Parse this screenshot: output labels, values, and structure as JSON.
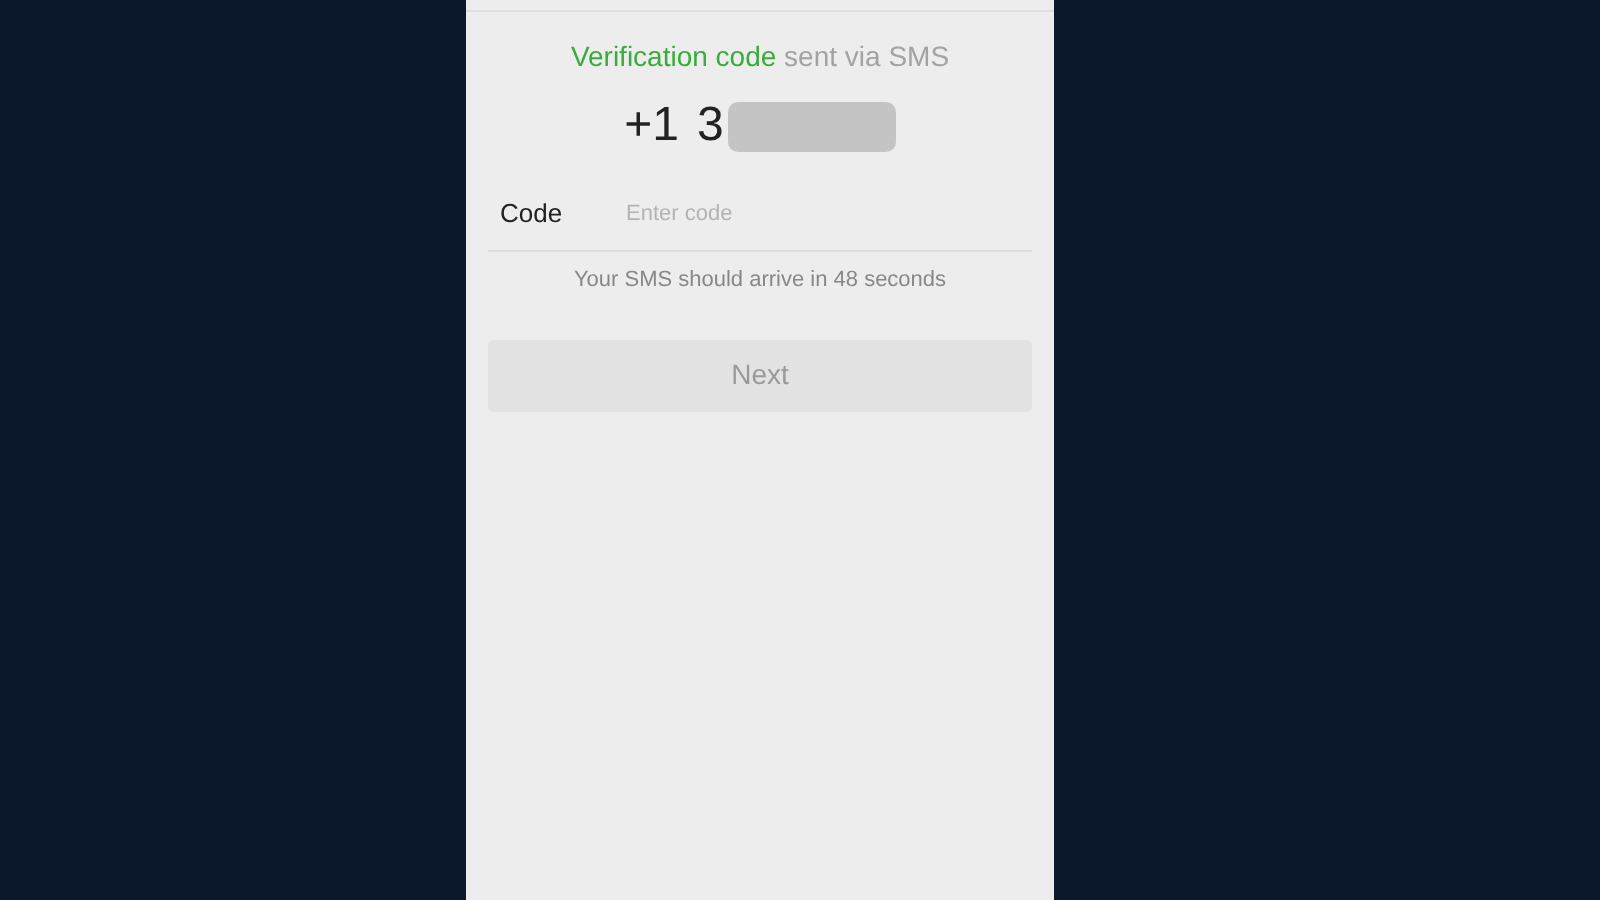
{
  "heading": {
    "highlight": "Verification code",
    "text": "sent via SMS"
  },
  "phone": {
    "prefix": "+1",
    "visible_digits": "3",
    "redacted": true
  },
  "code_field": {
    "label": "Code",
    "placeholder": "Enter code"
  },
  "hint": "Your SMS should arrive in 48 seconds",
  "next_button": {
    "label": "Next",
    "disabled": true
  }
}
